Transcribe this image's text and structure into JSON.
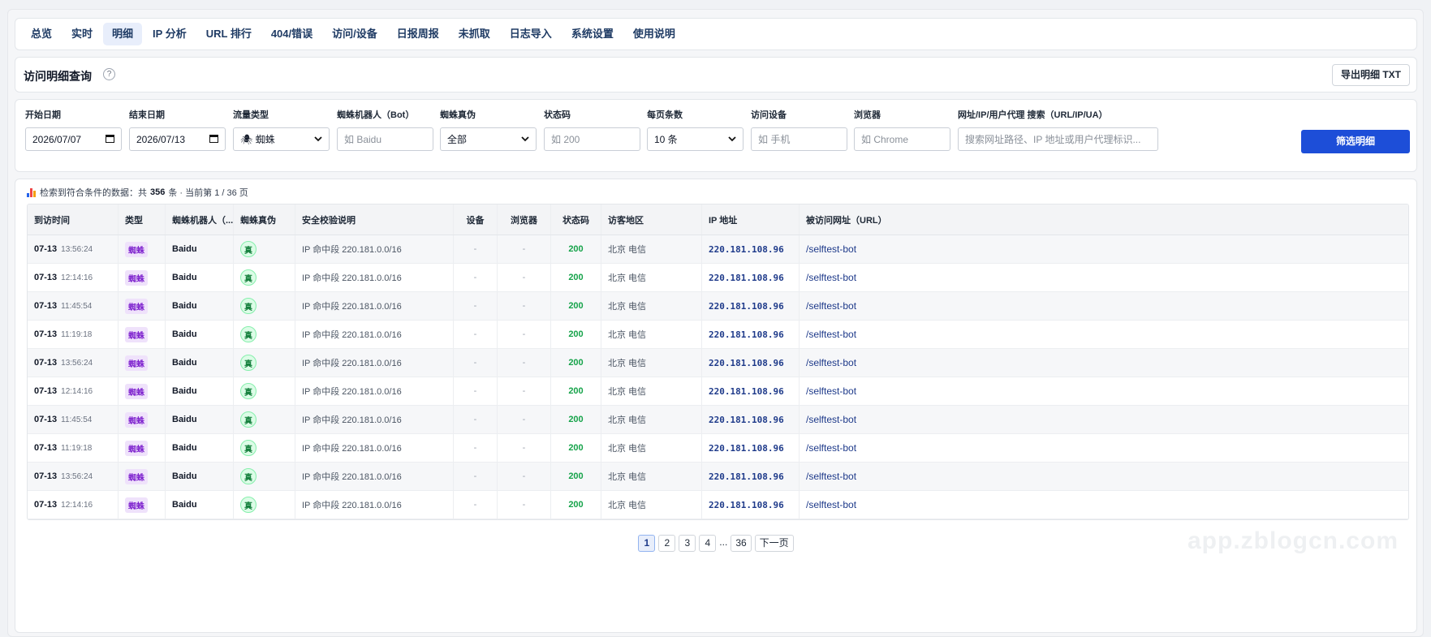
{
  "nav": {
    "tabs": [
      {
        "label": "总览"
      },
      {
        "label": "实时"
      },
      {
        "label": "明细",
        "active": true
      },
      {
        "label": "IP 分析"
      },
      {
        "label": "URL 排行"
      },
      {
        "label": "404/错误"
      },
      {
        "label": "访问/设备"
      },
      {
        "label": "日报周报"
      },
      {
        "label": "未抓取"
      },
      {
        "label": "日志导入"
      },
      {
        "label": "系统设置"
      },
      {
        "label": "使用说明"
      }
    ]
  },
  "header": {
    "title": "访问明细查询",
    "help": "?",
    "export_label": "导出明细 TXT"
  },
  "filters": {
    "start_date": {
      "label": "开始日期",
      "value": "2026/07/07"
    },
    "end_date": {
      "label": "结束日期",
      "value": "2026/07/13"
    },
    "traffic_type": {
      "label": "流量类型",
      "value": "🕷 蜘蛛"
    },
    "bot": {
      "label": "蜘蛛机器人（Bot）",
      "placeholder": "如 Baidu"
    },
    "authenticity": {
      "label": "蜘蛛真伪",
      "value": "全部"
    },
    "status_code": {
      "label": "状态码",
      "placeholder": "如 200"
    },
    "page_size": {
      "label": "每页条数",
      "value": "10 条"
    },
    "device": {
      "label": "访问设备",
      "placeholder": "如 手机"
    },
    "browser": {
      "label": "浏览器",
      "placeholder": "如 Chrome"
    },
    "search": {
      "label": "网址/IP/用户代理 搜索（URL/IP/UA）",
      "placeholder": "搜索网址路径、IP 地址或用户代理标识..."
    },
    "submit_label": "筛选明细"
  },
  "summary": {
    "prefix": "检索到符合条件的数据：共",
    "total": "356",
    "suffix": "条 · 当前第 1 / 36 页"
  },
  "table": {
    "columns": [
      "到访时间",
      "类型",
      "蜘蛛机器人（...",
      "蜘蛛真伪",
      "安全校验说明",
      "设备",
      "浏览器",
      "状态码",
      "访客地区",
      "IP 地址",
      "被访问网址（URL）"
    ],
    "rows": [
      {
        "date": "07-13",
        "time": "13:56:24",
        "type": "蜘蛛",
        "bot": "Baidu",
        "truth": "真",
        "note": "IP 命中段 220.181.0.0/16",
        "device": "-",
        "browser": "-",
        "status": "200",
        "region": "北京 电信",
        "ip": "220.181.108.96",
        "url": "/selftest-bot"
      },
      {
        "date": "07-13",
        "time": "12:14:16",
        "type": "蜘蛛",
        "bot": "Baidu",
        "truth": "真",
        "note": "IP 命中段 220.181.0.0/16",
        "device": "-",
        "browser": "-",
        "status": "200",
        "region": "北京 电信",
        "ip": "220.181.108.96",
        "url": "/selftest-bot"
      },
      {
        "date": "07-13",
        "time": "11:45:54",
        "type": "蜘蛛",
        "bot": "Baidu",
        "truth": "真",
        "note": "IP 命中段 220.181.0.0/16",
        "device": "-",
        "browser": "-",
        "status": "200",
        "region": "北京 电信",
        "ip": "220.181.108.96",
        "url": "/selftest-bot"
      },
      {
        "date": "07-13",
        "time": "11:19:18",
        "type": "蜘蛛",
        "bot": "Baidu",
        "truth": "真",
        "note": "IP 命中段 220.181.0.0/16",
        "device": "-",
        "browser": "-",
        "status": "200",
        "region": "北京 电信",
        "ip": "220.181.108.96",
        "url": "/selftest-bot"
      },
      {
        "date": "07-13",
        "time": "13:56:24",
        "type": "蜘蛛",
        "bot": "Baidu",
        "truth": "真",
        "note": "IP 命中段 220.181.0.0/16",
        "device": "-",
        "browser": "-",
        "status": "200",
        "region": "北京 电信",
        "ip": "220.181.108.96",
        "url": "/selftest-bot"
      },
      {
        "date": "07-13",
        "time": "12:14:16",
        "type": "蜘蛛",
        "bot": "Baidu",
        "truth": "真",
        "note": "IP 命中段 220.181.0.0/16",
        "device": "-",
        "browser": "-",
        "status": "200",
        "region": "北京 电信",
        "ip": "220.181.108.96",
        "url": "/selftest-bot"
      },
      {
        "date": "07-13",
        "time": "11:45:54",
        "type": "蜘蛛",
        "bot": "Baidu",
        "truth": "真",
        "note": "IP 命中段 220.181.0.0/16",
        "device": "-",
        "browser": "-",
        "status": "200",
        "region": "北京 电信",
        "ip": "220.181.108.96",
        "url": "/selftest-bot"
      },
      {
        "date": "07-13",
        "time": "11:19:18",
        "type": "蜘蛛",
        "bot": "Baidu",
        "truth": "真",
        "note": "IP 命中段 220.181.0.0/16",
        "device": "-",
        "browser": "-",
        "status": "200",
        "region": "北京 电信",
        "ip": "220.181.108.96",
        "url": "/selftest-bot"
      },
      {
        "date": "07-13",
        "time": "13:56:24",
        "type": "蜘蛛",
        "bot": "Baidu",
        "truth": "真",
        "note": "IP 命中段 220.181.0.0/16",
        "device": "-",
        "browser": "-",
        "status": "200",
        "region": "北京 电信",
        "ip": "220.181.108.96",
        "url": "/selftest-bot"
      },
      {
        "date": "07-13",
        "time": "12:14:16",
        "type": "蜘蛛",
        "bot": "Baidu",
        "truth": "真",
        "note": "IP 命中段 220.181.0.0/16",
        "device": "-",
        "browser": "-",
        "status": "200",
        "region": "北京 电信",
        "ip": "220.181.108.96",
        "url": "/selftest-bot"
      }
    ]
  },
  "pagination": {
    "pages": [
      "1",
      "2",
      "3",
      "4"
    ],
    "ellipsis": "...",
    "last": "36",
    "next_label": "下一页",
    "current": "1"
  },
  "watermark": "app.zblogcn.com",
  "icons": {
    "help": "question-circle-icon",
    "chart": "bar-chart-icon",
    "calendar": "calendar-icon",
    "select": "chevron-down-icon"
  },
  "colors": {
    "primary": "#1d4ed8",
    "status_ok": "#16a34a",
    "type_badge": "#7e22ce",
    "truth_badge": "#15803d"
  }
}
